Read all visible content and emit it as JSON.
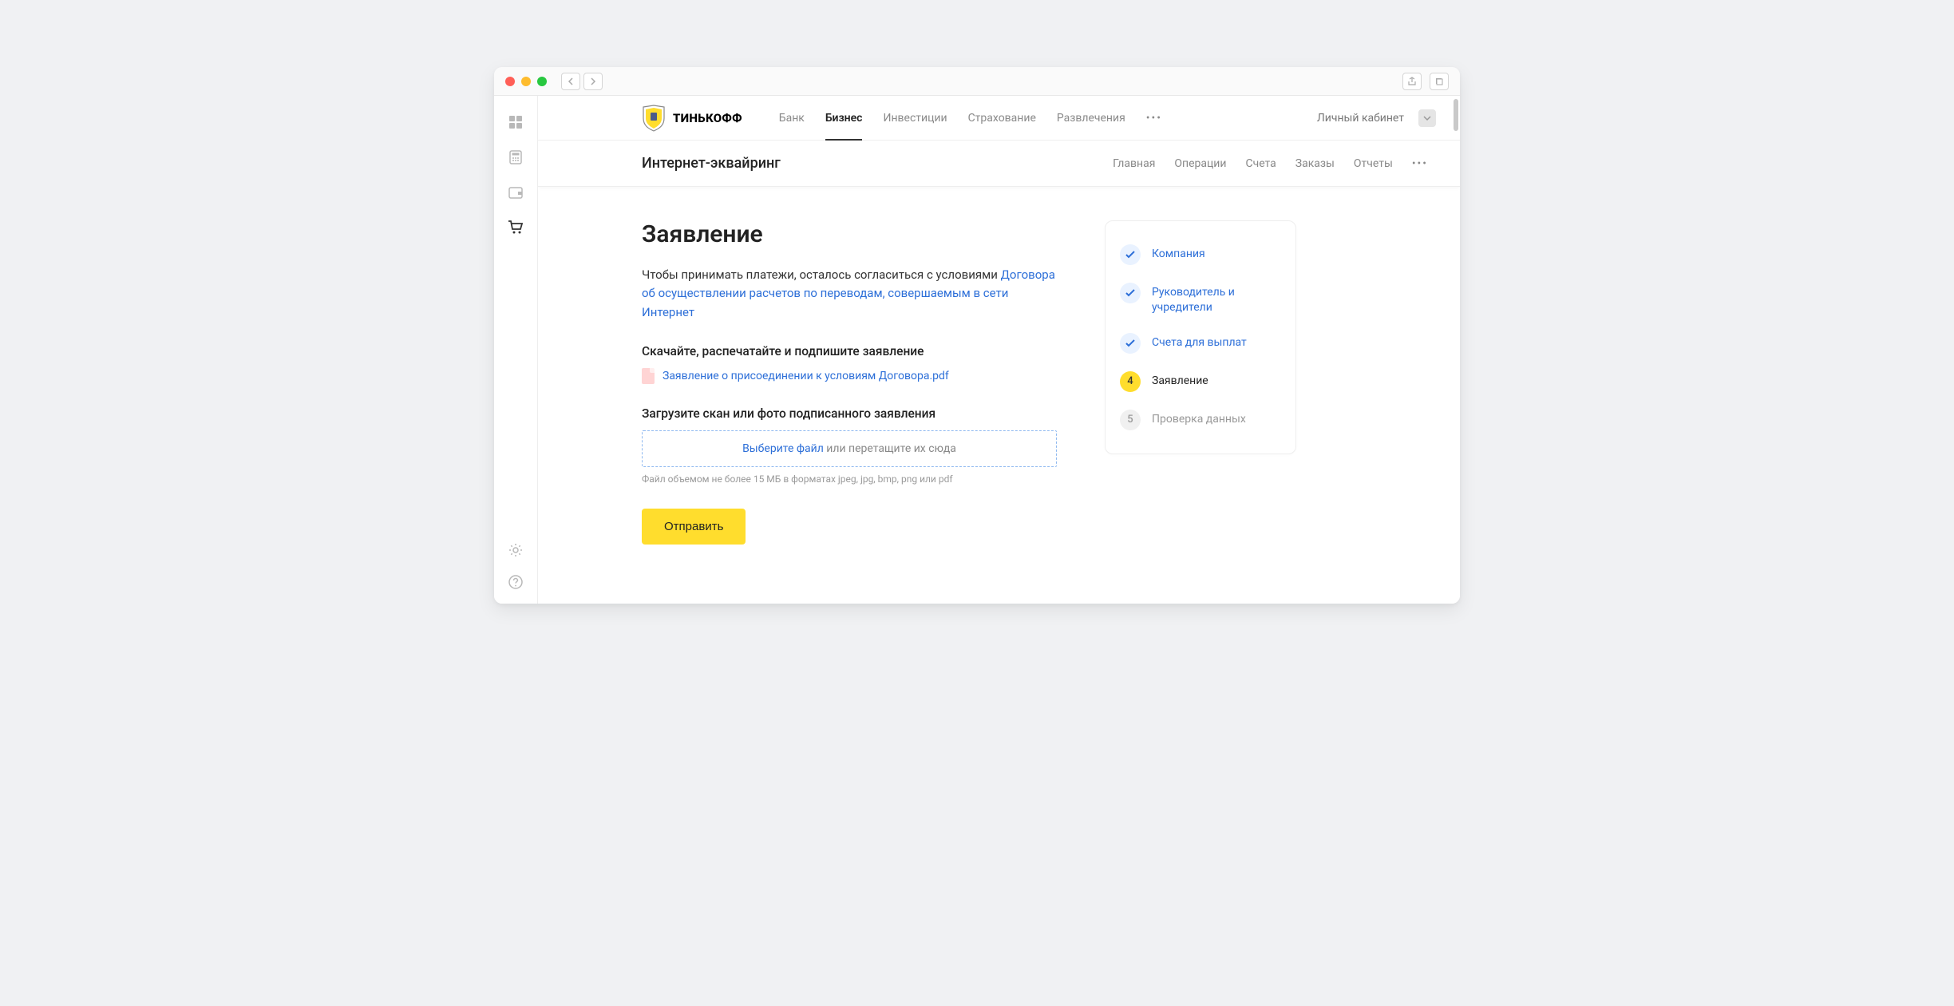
{
  "brand": "ТИНЬКОФФ",
  "topnav": {
    "items": [
      "Банк",
      "Бизнес",
      "Инвестиции",
      "Страхование",
      "Развлечения"
    ],
    "active_index": 1,
    "account_label": "Личный кабинет"
  },
  "subnav": {
    "title": "Интернет-эквайринг",
    "items": [
      "Главная",
      "Операции",
      "Счета",
      "Заказы",
      "Отчеты"
    ]
  },
  "page": {
    "title": "Заявление",
    "lead_plain": "Чтобы принимать платежи, осталось согласиться с условиями",
    "lead_link": "Договора об осуществлении расчетов по переводам, совершаемым в сети Интернет",
    "section_download": "Скачайте, распечатайте и подпишите заявление",
    "download_file": "Заявление о присоединении к условиям Договора.pdf",
    "section_upload": "Загрузите скан или фото подписанного заявления",
    "dropzone_pick": "Выберите файл",
    "dropzone_rest": " или перетащите их сюда",
    "upload_hint": "Файл объемом не более 15 МБ в форматах jpeg, jpg, bmp, png или pdf",
    "submit_label": "Отправить"
  },
  "stepper": [
    {
      "state": "done",
      "label": "Компания"
    },
    {
      "state": "done",
      "label": "Руководитель и учредители"
    },
    {
      "state": "done",
      "label": "Счета для выплат"
    },
    {
      "state": "current",
      "num": "4",
      "label": "Заявление"
    },
    {
      "state": "pending",
      "num": "5",
      "label": "Проверка данных"
    }
  ]
}
